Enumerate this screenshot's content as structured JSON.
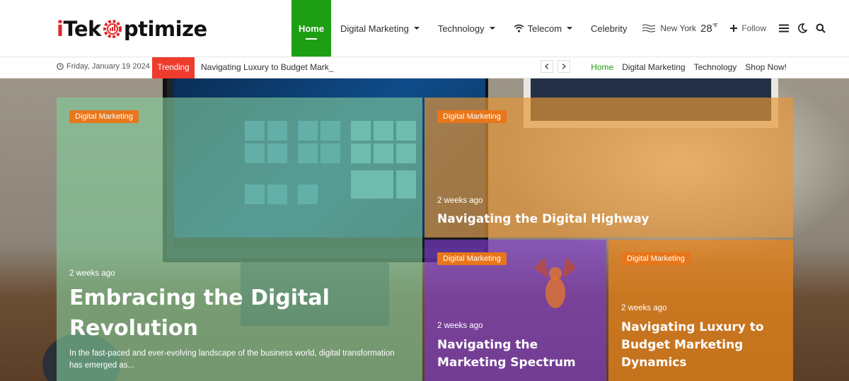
{
  "colors": {
    "brand_green": "#1c9f12",
    "trending_red": "#ef3b2d",
    "tag_orange": "#e8761a",
    "logo_red": "#e0282b"
  },
  "logo": {
    "part1": "i",
    "part2": "Tek",
    "part3": "ptimize"
  },
  "nav": {
    "items": [
      {
        "label": "Home",
        "active": true
      },
      {
        "label": "Digital Marketing",
        "dropdown": true
      },
      {
        "label": "Technology",
        "dropdown": true
      },
      {
        "label": "Telecom",
        "dropdown": true,
        "icon": "wifi-icon"
      },
      {
        "label": "Celebrity"
      }
    ],
    "weather": {
      "city": "New York",
      "temp": "28",
      "unit": "℉",
      "icon": "wind-icon"
    },
    "follow_label": "Follow",
    "icons": [
      "menu-icon",
      "moon-icon",
      "search-icon"
    ]
  },
  "topbar": {
    "date": "Friday, January 19 2024",
    "trending_label": "Trending",
    "ticker": "Navigating Luxury to Budget Mark_",
    "links": [
      "Home",
      "Digital Marketing",
      "Technology",
      "Shop Now!"
    ]
  },
  "cards": [
    {
      "tag": "Digital Marketing",
      "meta": "2 weeks ago",
      "title_line1": "Embracing the Digital",
      "title_line2": "Revolution",
      "excerpt": "In the fast-paced and ever-evolving landscape of the business world, digital transformation has emerged as..."
    },
    {
      "tag": "Digital Marketing",
      "meta": "2 weeks ago",
      "title": "Navigating the Digital Highway"
    },
    {
      "tag": "Digital Marketing",
      "meta": "2 weeks ago",
      "title_line1": "Navigating the",
      "title_line2": "Marketing Spectrum"
    },
    {
      "tag": "Digital Marketing",
      "meta": "2 weeks ago",
      "title_line1": "Navigating Luxury to",
      "title_line2": "Budget Marketing",
      "title_line3": "Dynamics"
    }
  ]
}
